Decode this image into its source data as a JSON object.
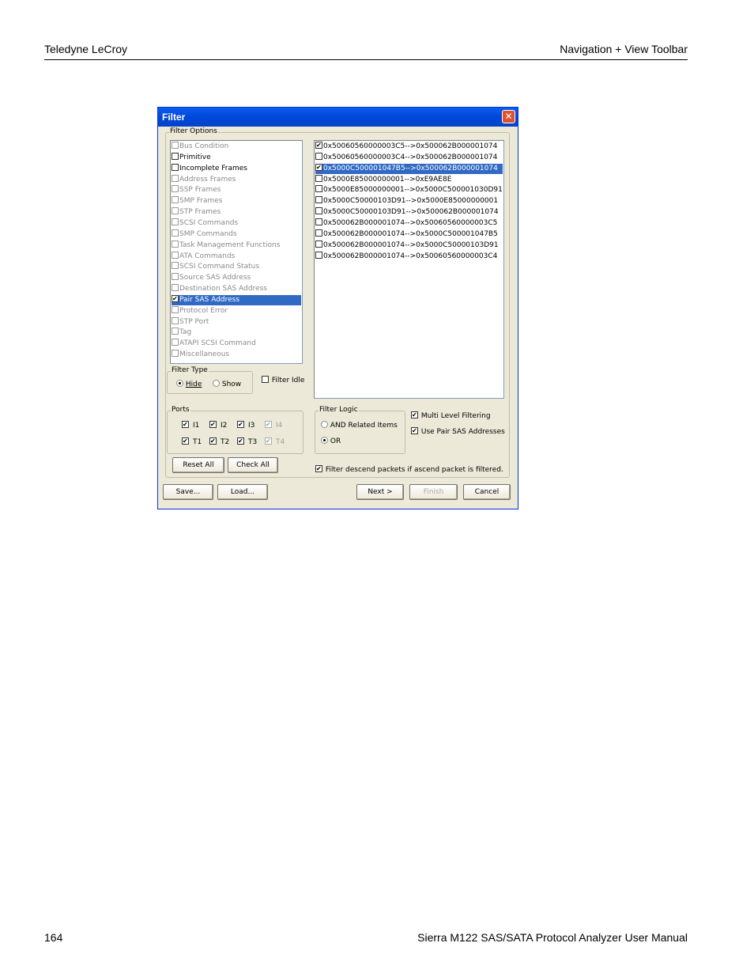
{
  "page": {
    "header_left": "Teledyne LeCroy",
    "header_right": "Navigation + View Toolbar",
    "footer_left": "164",
    "footer_right": "Sierra M122 SAS/SATA Protocol Analyzer User Manual"
  },
  "dialog": {
    "title": "Filter",
    "close_glyph": "✕",
    "filter_options_label": "Filter Options",
    "filter_options": [
      {
        "label": "Bus Condition",
        "checked": false,
        "enabled": false,
        "selected": false
      },
      {
        "label": "Primitive",
        "checked": false,
        "enabled": true,
        "selected": false
      },
      {
        "label": "Incomplete Frames",
        "checked": false,
        "enabled": true,
        "selected": false
      },
      {
        "label": "Address Frames",
        "checked": false,
        "enabled": false,
        "selected": false
      },
      {
        "label": "SSP Frames",
        "checked": false,
        "enabled": false,
        "selected": false
      },
      {
        "label": "SMP Frames",
        "checked": false,
        "enabled": false,
        "selected": false
      },
      {
        "label": "STP Frames",
        "checked": false,
        "enabled": false,
        "selected": false
      },
      {
        "label": "SCSI Commands",
        "checked": false,
        "enabled": false,
        "selected": false
      },
      {
        "label": "SMP Commands",
        "checked": false,
        "enabled": false,
        "selected": false
      },
      {
        "label": "Task Management Functions",
        "checked": false,
        "enabled": false,
        "selected": false
      },
      {
        "label": "ATA Commands",
        "checked": false,
        "enabled": false,
        "selected": false
      },
      {
        "label": "SCSI Command Status",
        "checked": false,
        "enabled": false,
        "selected": false
      },
      {
        "label": "Source SAS Address",
        "checked": false,
        "enabled": false,
        "selected": false
      },
      {
        "label": "Destination SAS Address",
        "checked": false,
        "enabled": false,
        "selected": false
      },
      {
        "label": "Pair SAS Address",
        "checked": true,
        "enabled": true,
        "selected": true
      },
      {
        "label": "Protocol Error",
        "checked": false,
        "enabled": false,
        "selected": false
      },
      {
        "label": "STP Port",
        "checked": false,
        "enabled": false,
        "selected": false
      },
      {
        "label": "Tag",
        "checked": false,
        "enabled": false,
        "selected": false
      },
      {
        "label": "ATAPI SCSI Command",
        "checked": false,
        "enabled": false,
        "selected": false
      },
      {
        "label": "Miscellaneous",
        "checked": false,
        "enabled": false,
        "selected": false
      }
    ],
    "address_pairs": [
      {
        "label": "0x50060560000003C5-->0x500062B000001074",
        "checked": true,
        "selected": false
      },
      {
        "label": "0x50060560000003C4-->0x500062B000001074",
        "checked": false,
        "selected": false
      },
      {
        "label": "0x5000C500001047B5-->0x500062B000001074",
        "checked": true,
        "selected": true
      },
      {
        "label": "0x5000E85000000001-->0xE9AE8E",
        "checked": false,
        "selected": false
      },
      {
        "label": "0x5000E85000000001-->0x5000C500001030D91",
        "checked": false,
        "selected": false
      },
      {
        "label": "0x5000C50000103D91-->0x5000E85000000001",
        "checked": false,
        "selected": false
      },
      {
        "label": "0x5000C50000103D91-->0x500062B000001074",
        "checked": false,
        "selected": false
      },
      {
        "label": "0x500062B000001074-->0x50060560000003C5",
        "checked": false,
        "selected": false
      },
      {
        "label": "0x500062B000001074-->0x5000C500001047B5",
        "checked": false,
        "selected": false
      },
      {
        "label": "0x500062B000001074-->0x5000C50000103D91",
        "checked": false,
        "selected": false
      },
      {
        "label": "0x500062B000001074-->0x50060560000003C4",
        "checked": false,
        "selected": false
      }
    ],
    "filter_type": {
      "label": "Filter Type",
      "hide_label": "Hide",
      "show_label": "Show",
      "selected": "hide"
    },
    "filter_idle": {
      "label": "Filter Idle",
      "checked": false
    },
    "ports": {
      "label": "Ports",
      "items": [
        {
          "label": "I1",
          "checked": true,
          "enabled": true
        },
        {
          "label": "I2",
          "checked": true,
          "enabled": true
        },
        {
          "label": "I3",
          "checked": true,
          "enabled": true
        },
        {
          "label": "I4",
          "checked": true,
          "enabled": false
        },
        {
          "label": "T1",
          "checked": true,
          "enabled": true
        },
        {
          "label": "T2",
          "checked": true,
          "enabled": true
        },
        {
          "label": "T3",
          "checked": true,
          "enabled": true
        },
        {
          "label": "T4",
          "checked": true,
          "enabled": false
        }
      ]
    },
    "filter_logic": {
      "label": "Filter Logic",
      "and_label": "AND Related Items",
      "or_label": "OR",
      "selected": "or"
    },
    "multi_level": {
      "label": "Multi Level Filtering",
      "checked": true
    },
    "use_pair": {
      "label": "Use Pair SAS Addresses",
      "checked": true
    },
    "filter_descend": {
      "label": "Filter descend packets if ascend packet is filtered.",
      "checked": true
    },
    "buttons": {
      "reset_all": "Reset All",
      "check_all": "Check All",
      "save": "Save...",
      "load": "Load...",
      "next": "Next >",
      "finish": "Finish",
      "cancel": "Cancel"
    }
  }
}
